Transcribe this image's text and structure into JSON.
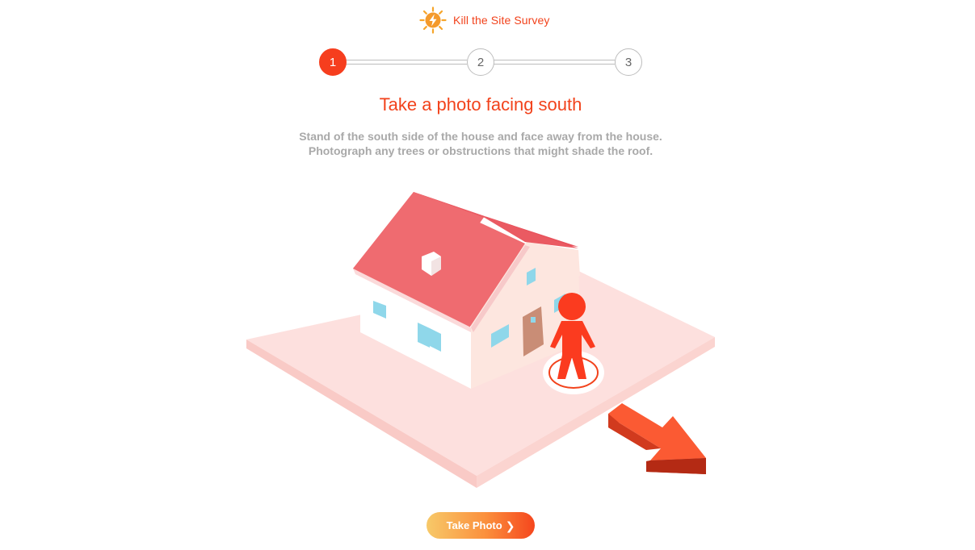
{
  "brand": {
    "name": "Kill the Site Survey",
    "icon": "sun-bolt-icon"
  },
  "stepper": {
    "steps": [
      "1",
      "2",
      "3"
    ],
    "active_step": 1
  },
  "main": {
    "title": "Take a photo facing south",
    "description_line1": "Stand of the south side of the house and face away from the house.",
    "description_line2": "Photograph any trees or obstructions that might shade the roof."
  },
  "actions": {
    "take_photo_label": "Take Photo",
    "take_photo_icon": "chevron-right-icon"
  },
  "colors": {
    "accent": "#f2421b",
    "step_active": "#f63e1e",
    "ground": "#fcdcdc",
    "roof": "#ef6b70",
    "person": "#fb3b1f",
    "arrow": "#fb5a33",
    "button_gradient_start": "#f7c969",
    "button_gradient_end": "#f5461d"
  }
}
